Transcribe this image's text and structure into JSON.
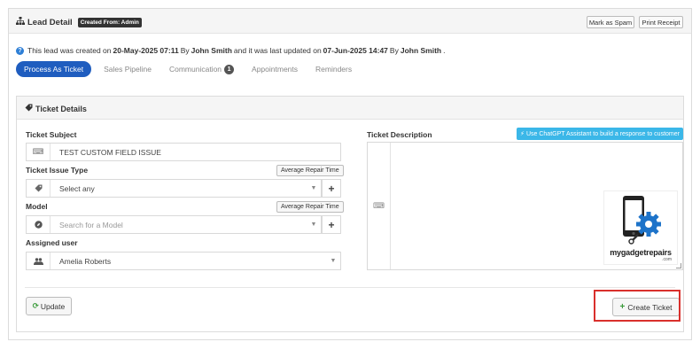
{
  "header": {
    "title": "Lead Detail",
    "badge": "Created From: Admin",
    "mark_spam": "Mark as Spam",
    "print_receipt": "Print Receipt"
  },
  "info": {
    "p1": "This lead was created on",
    "created_date": "20-May-2025 07:11",
    "p2": "By",
    "created_by": "John Smith",
    "p3": "and it was last updated on",
    "updated_date": "07-Jun-2025 14:47",
    "p4": "By",
    "updated_by": "John Smith",
    "p5": "."
  },
  "tabs": [
    {
      "label": "Process As Ticket",
      "active": true
    },
    {
      "label": "Sales Pipeline"
    },
    {
      "label": "Communication",
      "count": "1"
    },
    {
      "label": "Appointments"
    },
    {
      "label": "Reminders"
    }
  ],
  "ticket": {
    "section_title": "Ticket Details",
    "subject_label": "Ticket Subject",
    "subject_value": "TEST CUSTOM FIELD ISSUE",
    "issue_type_label": "Ticket Issue Type",
    "issue_type_value": "Select any",
    "avg_repair_time": "Average Repair Time",
    "model_label": "Model",
    "model_placeholder": "Search for a Model",
    "assigned_label": "Assigned user",
    "assigned_value": "Amelia Roberts",
    "description_label": "Ticket Description",
    "gpt_button": "Use ChatGPT Assistant to build a response to customer",
    "logo_text": "mygadgetrepairs",
    "logo_com": ".com",
    "update_button": "Update",
    "create_button": "Create Ticket"
  },
  "colors": {
    "tab_active": "#1f5dbf",
    "gpt_button": "#3bb7e8",
    "highlight": "#d9302c",
    "create_plus": "#3a9a3a"
  },
  "icons": [
    "sitemap-icon",
    "info-icon",
    "tag-icon",
    "keyboard-icon",
    "compass-icon",
    "users-icon",
    "plus-icon",
    "lightning-icon",
    "refresh-icon",
    "phone-gear-icon"
  ]
}
